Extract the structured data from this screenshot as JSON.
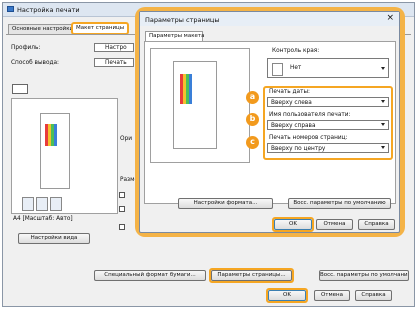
{
  "back": {
    "title": "Настройка печати",
    "tabs": [
      "Основные настройки",
      "Макет страницы"
    ],
    "profile_label": "Профиль:",
    "profile_value": "Настро",
    "output_label": "Способ вывода:",
    "output_value": "Печать",
    "preview_caption": "A4 [Масштаб: Авто]",
    "settings_view_button": "Настройки вида",
    "orientation_label": "Ори",
    "layout_label": "Разме",
    "special_format_button": "Специальный формат бумаги...",
    "page_setup_button": "Параметры страницы...",
    "restore_defaults_button": "Восс. параметры по умолчанию",
    "ok_button": "OK",
    "cancel_button": "Отмена",
    "help_button": "Справка"
  },
  "front": {
    "title": "Параметры страницы",
    "tab": "Параметры макета",
    "border_label": "Контроль края:",
    "border_value": "Нет",
    "print_date_label": "Печать даты:",
    "print_date_value": "Вверху слева",
    "print_user_label": "Имя пользователя печати:",
    "print_user_value": "Вверху справа",
    "print_page_label": "Печать номеров страниц:",
    "print_page_value": "Вверху по центру",
    "format_settings_button": "Настройки формата...",
    "restore_defaults_button": "Восс. параметры по умолчанию",
    "ok_button": "OK",
    "cancel_button": "Отмена",
    "help_button": "Справка"
  },
  "badges": [
    "a",
    "b",
    "c"
  ],
  "colors": {
    "highlight": "#f5a623",
    "badge": "#f29a1d"
  }
}
